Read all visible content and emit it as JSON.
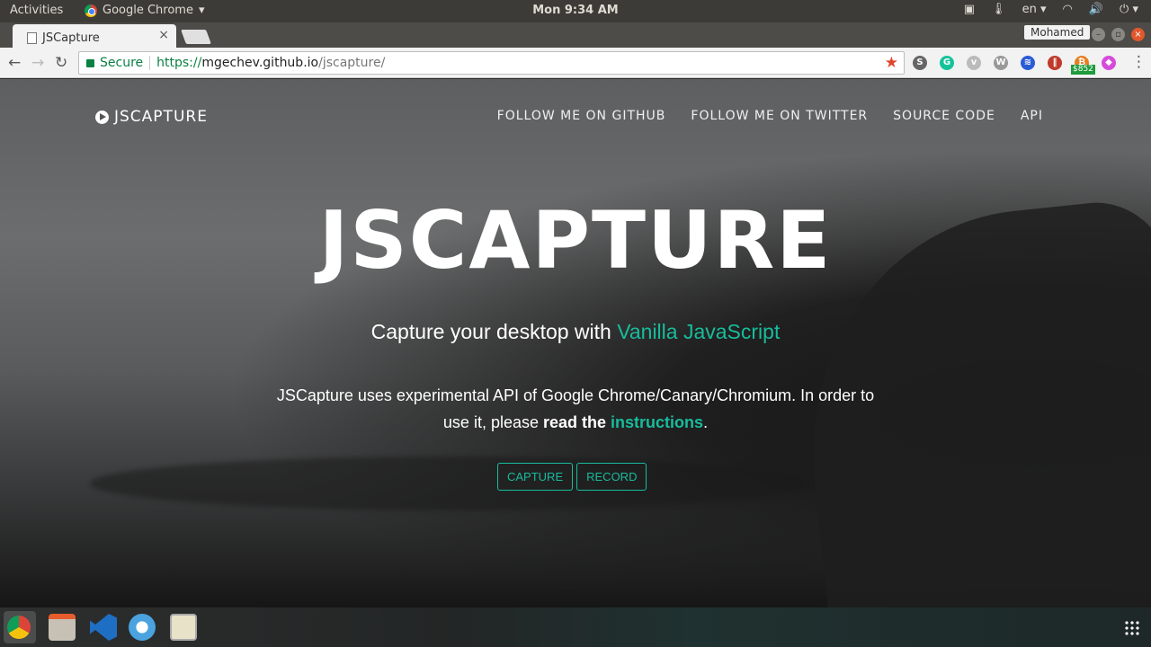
{
  "topbar": {
    "activities": "Activities",
    "app_name": "Google Chrome",
    "clock": "Mon  9:34 AM",
    "lang": "en"
  },
  "browser": {
    "tab_title": "JSCapture",
    "tab_close": "×",
    "profile_name": "Mohamed",
    "secure_label": "Secure",
    "url_scheme": "https://",
    "url_host": "mgechev.github.io",
    "url_path": "/jscapture/",
    "extension_badge": "$852"
  },
  "site": {
    "brand": "JSCAPTURE",
    "nav": [
      "FOLLOW ME ON GITHUB",
      "FOLLOW ME ON TWITTER",
      "SOURCE CODE",
      "API"
    ],
    "hero_title": "JSCAPTURE",
    "tagline_prefix": "Capture your desktop with ",
    "tagline_accent": "Vanilla JavaScript",
    "desc_line1": "JSCapture uses experimental API of Google Chrome/Canary/Chromium. In order to",
    "desc_line2_prefix": "use it, please ",
    "desc_bold": "read the",
    "desc_link": "instructions",
    "desc_suffix": ".",
    "capture_label": "CAPTURE",
    "record_label": "RECORD"
  },
  "colors": {
    "accent": "#18bc9c"
  }
}
